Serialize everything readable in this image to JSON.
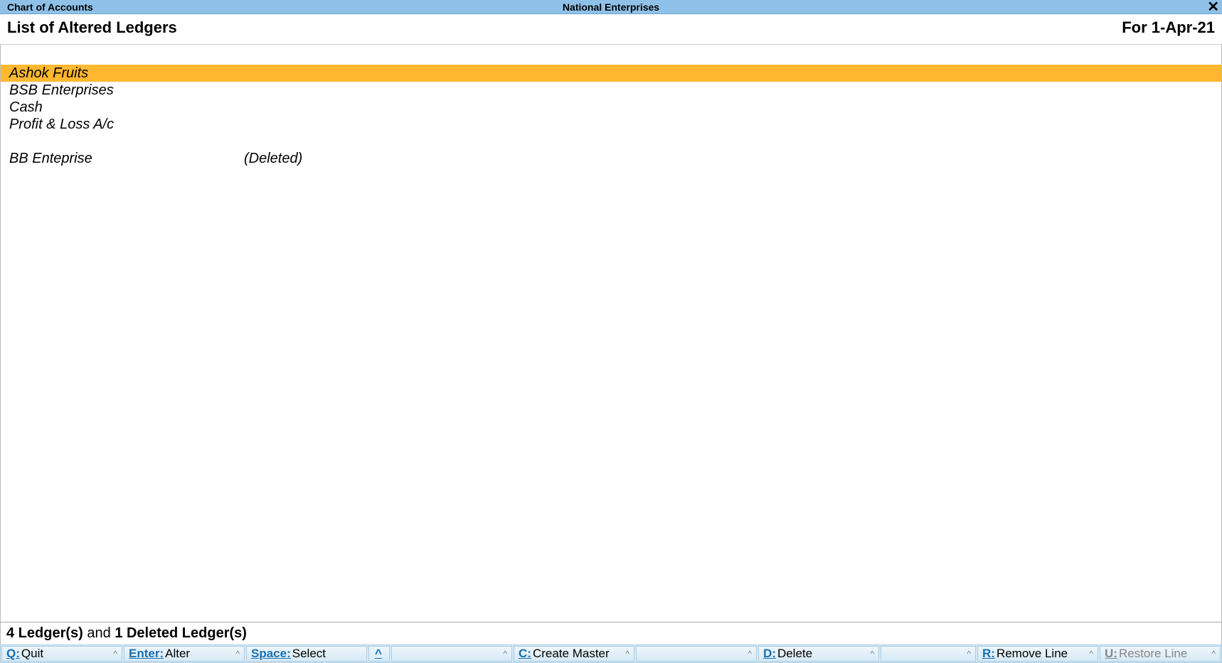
{
  "titlebar": {
    "left": "Chart of Accounts",
    "center": "National Enterprises",
    "close": "✕"
  },
  "header": {
    "left": "List of Altered Ledgers",
    "right": "For 1-Apr-21"
  },
  "ledgers": [
    {
      "name": "Ashok Fruits",
      "status": "",
      "selected": true
    },
    {
      "name": "BSB Enterprises",
      "status": "",
      "selected": false
    },
    {
      "name": "Cash",
      "status": "",
      "selected": false
    },
    {
      "name": "Profit & Loss A/c",
      "status": "",
      "selected": false
    }
  ],
  "deleted_ledgers": [
    {
      "name": "BB Enteprise",
      "status": "(Deleted)"
    }
  ],
  "summary": {
    "count_text": "4 Ledger(s)",
    "and_text": " and ",
    "deleted_text": "1 Deleted Ledger(s)"
  },
  "actions": {
    "quit": {
      "key": "Q:",
      "label": "Quit"
    },
    "alter": {
      "key": "Enter:",
      "label": "Alter"
    },
    "select": {
      "key": "Space:",
      "label": "Select"
    },
    "caret_only": {
      "key": "",
      "label": ""
    },
    "create": {
      "key": "C:",
      "label": "Create Master"
    },
    "delete": {
      "key": "D:",
      "label": "Delete"
    },
    "remove": {
      "key": "R:",
      "label": "Remove Line"
    },
    "restore": {
      "key": "U:",
      "label": "Restore Line"
    }
  }
}
